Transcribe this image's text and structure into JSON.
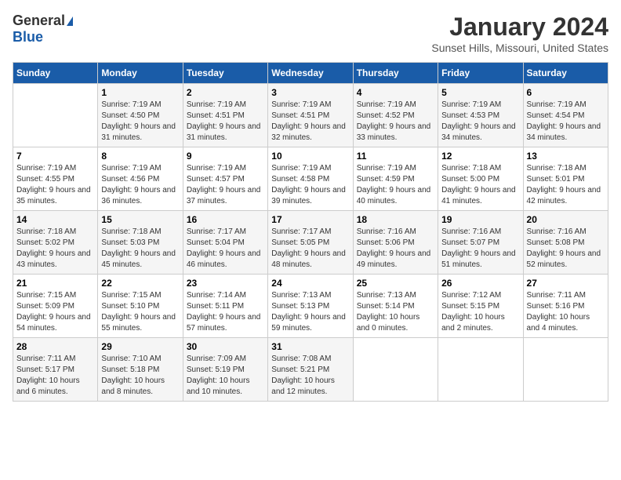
{
  "header": {
    "logo_general": "General",
    "logo_blue": "Blue",
    "month_title": "January 2024",
    "location": "Sunset Hills, Missouri, United States"
  },
  "days_of_week": [
    "Sunday",
    "Monday",
    "Tuesday",
    "Wednesday",
    "Thursday",
    "Friday",
    "Saturday"
  ],
  "weeks": [
    [
      {
        "day": "",
        "sunrise": "",
        "sunset": "",
        "daylight": ""
      },
      {
        "day": "1",
        "sunrise": "Sunrise: 7:19 AM",
        "sunset": "Sunset: 4:50 PM",
        "daylight": "Daylight: 9 hours and 31 minutes."
      },
      {
        "day": "2",
        "sunrise": "Sunrise: 7:19 AM",
        "sunset": "Sunset: 4:51 PM",
        "daylight": "Daylight: 9 hours and 31 minutes."
      },
      {
        "day": "3",
        "sunrise": "Sunrise: 7:19 AM",
        "sunset": "Sunset: 4:51 PM",
        "daylight": "Daylight: 9 hours and 32 minutes."
      },
      {
        "day": "4",
        "sunrise": "Sunrise: 7:19 AM",
        "sunset": "Sunset: 4:52 PM",
        "daylight": "Daylight: 9 hours and 33 minutes."
      },
      {
        "day": "5",
        "sunrise": "Sunrise: 7:19 AM",
        "sunset": "Sunset: 4:53 PM",
        "daylight": "Daylight: 9 hours and 34 minutes."
      },
      {
        "day": "6",
        "sunrise": "Sunrise: 7:19 AM",
        "sunset": "Sunset: 4:54 PM",
        "daylight": "Daylight: 9 hours and 34 minutes."
      }
    ],
    [
      {
        "day": "7",
        "sunrise": "Sunrise: 7:19 AM",
        "sunset": "Sunset: 4:55 PM",
        "daylight": "Daylight: 9 hours and 35 minutes."
      },
      {
        "day": "8",
        "sunrise": "Sunrise: 7:19 AM",
        "sunset": "Sunset: 4:56 PM",
        "daylight": "Daylight: 9 hours and 36 minutes."
      },
      {
        "day": "9",
        "sunrise": "Sunrise: 7:19 AM",
        "sunset": "Sunset: 4:57 PM",
        "daylight": "Daylight: 9 hours and 37 minutes."
      },
      {
        "day": "10",
        "sunrise": "Sunrise: 7:19 AM",
        "sunset": "Sunset: 4:58 PM",
        "daylight": "Daylight: 9 hours and 39 minutes."
      },
      {
        "day": "11",
        "sunrise": "Sunrise: 7:19 AM",
        "sunset": "Sunset: 4:59 PM",
        "daylight": "Daylight: 9 hours and 40 minutes."
      },
      {
        "day": "12",
        "sunrise": "Sunrise: 7:18 AM",
        "sunset": "Sunset: 5:00 PM",
        "daylight": "Daylight: 9 hours and 41 minutes."
      },
      {
        "day": "13",
        "sunrise": "Sunrise: 7:18 AM",
        "sunset": "Sunset: 5:01 PM",
        "daylight": "Daylight: 9 hours and 42 minutes."
      }
    ],
    [
      {
        "day": "14",
        "sunrise": "Sunrise: 7:18 AM",
        "sunset": "Sunset: 5:02 PM",
        "daylight": "Daylight: 9 hours and 43 minutes."
      },
      {
        "day": "15",
        "sunrise": "Sunrise: 7:18 AM",
        "sunset": "Sunset: 5:03 PM",
        "daylight": "Daylight: 9 hours and 45 minutes."
      },
      {
        "day": "16",
        "sunrise": "Sunrise: 7:17 AM",
        "sunset": "Sunset: 5:04 PM",
        "daylight": "Daylight: 9 hours and 46 minutes."
      },
      {
        "day": "17",
        "sunrise": "Sunrise: 7:17 AM",
        "sunset": "Sunset: 5:05 PM",
        "daylight": "Daylight: 9 hours and 48 minutes."
      },
      {
        "day": "18",
        "sunrise": "Sunrise: 7:16 AM",
        "sunset": "Sunset: 5:06 PM",
        "daylight": "Daylight: 9 hours and 49 minutes."
      },
      {
        "day": "19",
        "sunrise": "Sunrise: 7:16 AM",
        "sunset": "Sunset: 5:07 PM",
        "daylight": "Daylight: 9 hours and 51 minutes."
      },
      {
        "day": "20",
        "sunrise": "Sunrise: 7:16 AM",
        "sunset": "Sunset: 5:08 PM",
        "daylight": "Daylight: 9 hours and 52 minutes."
      }
    ],
    [
      {
        "day": "21",
        "sunrise": "Sunrise: 7:15 AM",
        "sunset": "Sunset: 5:09 PM",
        "daylight": "Daylight: 9 hours and 54 minutes."
      },
      {
        "day": "22",
        "sunrise": "Sunrise: 7:15 AM",
        "sunset": "Sunset: 5:10 PM",
        "daylight": "Daylight: 9 hours and 55 minutes."
      },
      {
        "day": "23",
        "sunrise": "Sunrise: 7:14 AM",
        "sunset": "Sunset: 5:11 PM",
        "daylight": "Daylight: 9 hours and 57 minutes."
      },
      {
        "day": "24",
        "sunrise": "Sunrise: 7:13 AM",
        "sunset": "Sunset: 5:13 PM",
        "daylight": "Daylight: 9 hours and 59 minutes."
      },
      {
        "day": "25",
        "sunrise": "Sunrise: 7:13 AM",
        "sunset": "Sunset: 5:14 PM",
        "daylight": "Daylight: 10 hours and 0 minutes."
      },
      {
        "day": "26",
        "sunrise": "Sunrise: 7:12 AM",
        "sunset": "Sunset: 5:15 PM",
        "daylight": "Daylight: 10 hours and 2 minutes."
      },
      {
        "day": "27",
        "sunrise": "Sunrise: 7:11 AM",
        "sunset": "Sunset: 5:16 PM",
        "daylight": "Daylight: 10 hours and 4 minutes."
      }
    ],
    [
      {
        "day": "28",
        "sunrise": "Sunrise: 7:11 AM",
        "sunset": "Sunset: 5:17 PM",
        "daylight": "Daylight: 10 hours and 6 minutes."
      },
      {
        "day": "29",
        "sunrise": "Sunrise: 7:10 AM",
        "sunset": "Sunset: 5:18 PM",
        "daylight": "Daylight: 10 hours and 8 minutes."
      },
      {
        "day": "30",
        "sunrise": "Sunrise: 7:09 AM",
        "sunset": "Sunset: 5:19 PM",
        "daylight": "Daylight: 10 hours and 10 minutes."
      },
      {
        "day": "31",
        "sunrise": "Sunrise: 7:08 AM",
        "sunset": "Sunset: 5:21 PM",
        "daylight": "Daylight: 10 hours and 12 minutes."
      },
      {
        "day": "",
        "sunrise": "",
        "sunset": "",
        "daylight": ""
      },
      {
        "day": "",
        "sunrise": "",
        "sunset": "",
        "daylight": ""
      },
      {
        "day": "",
        "sunrise": "",
        "sunset": "",
        "daylight": ""
      }
    ]
  ]
}
